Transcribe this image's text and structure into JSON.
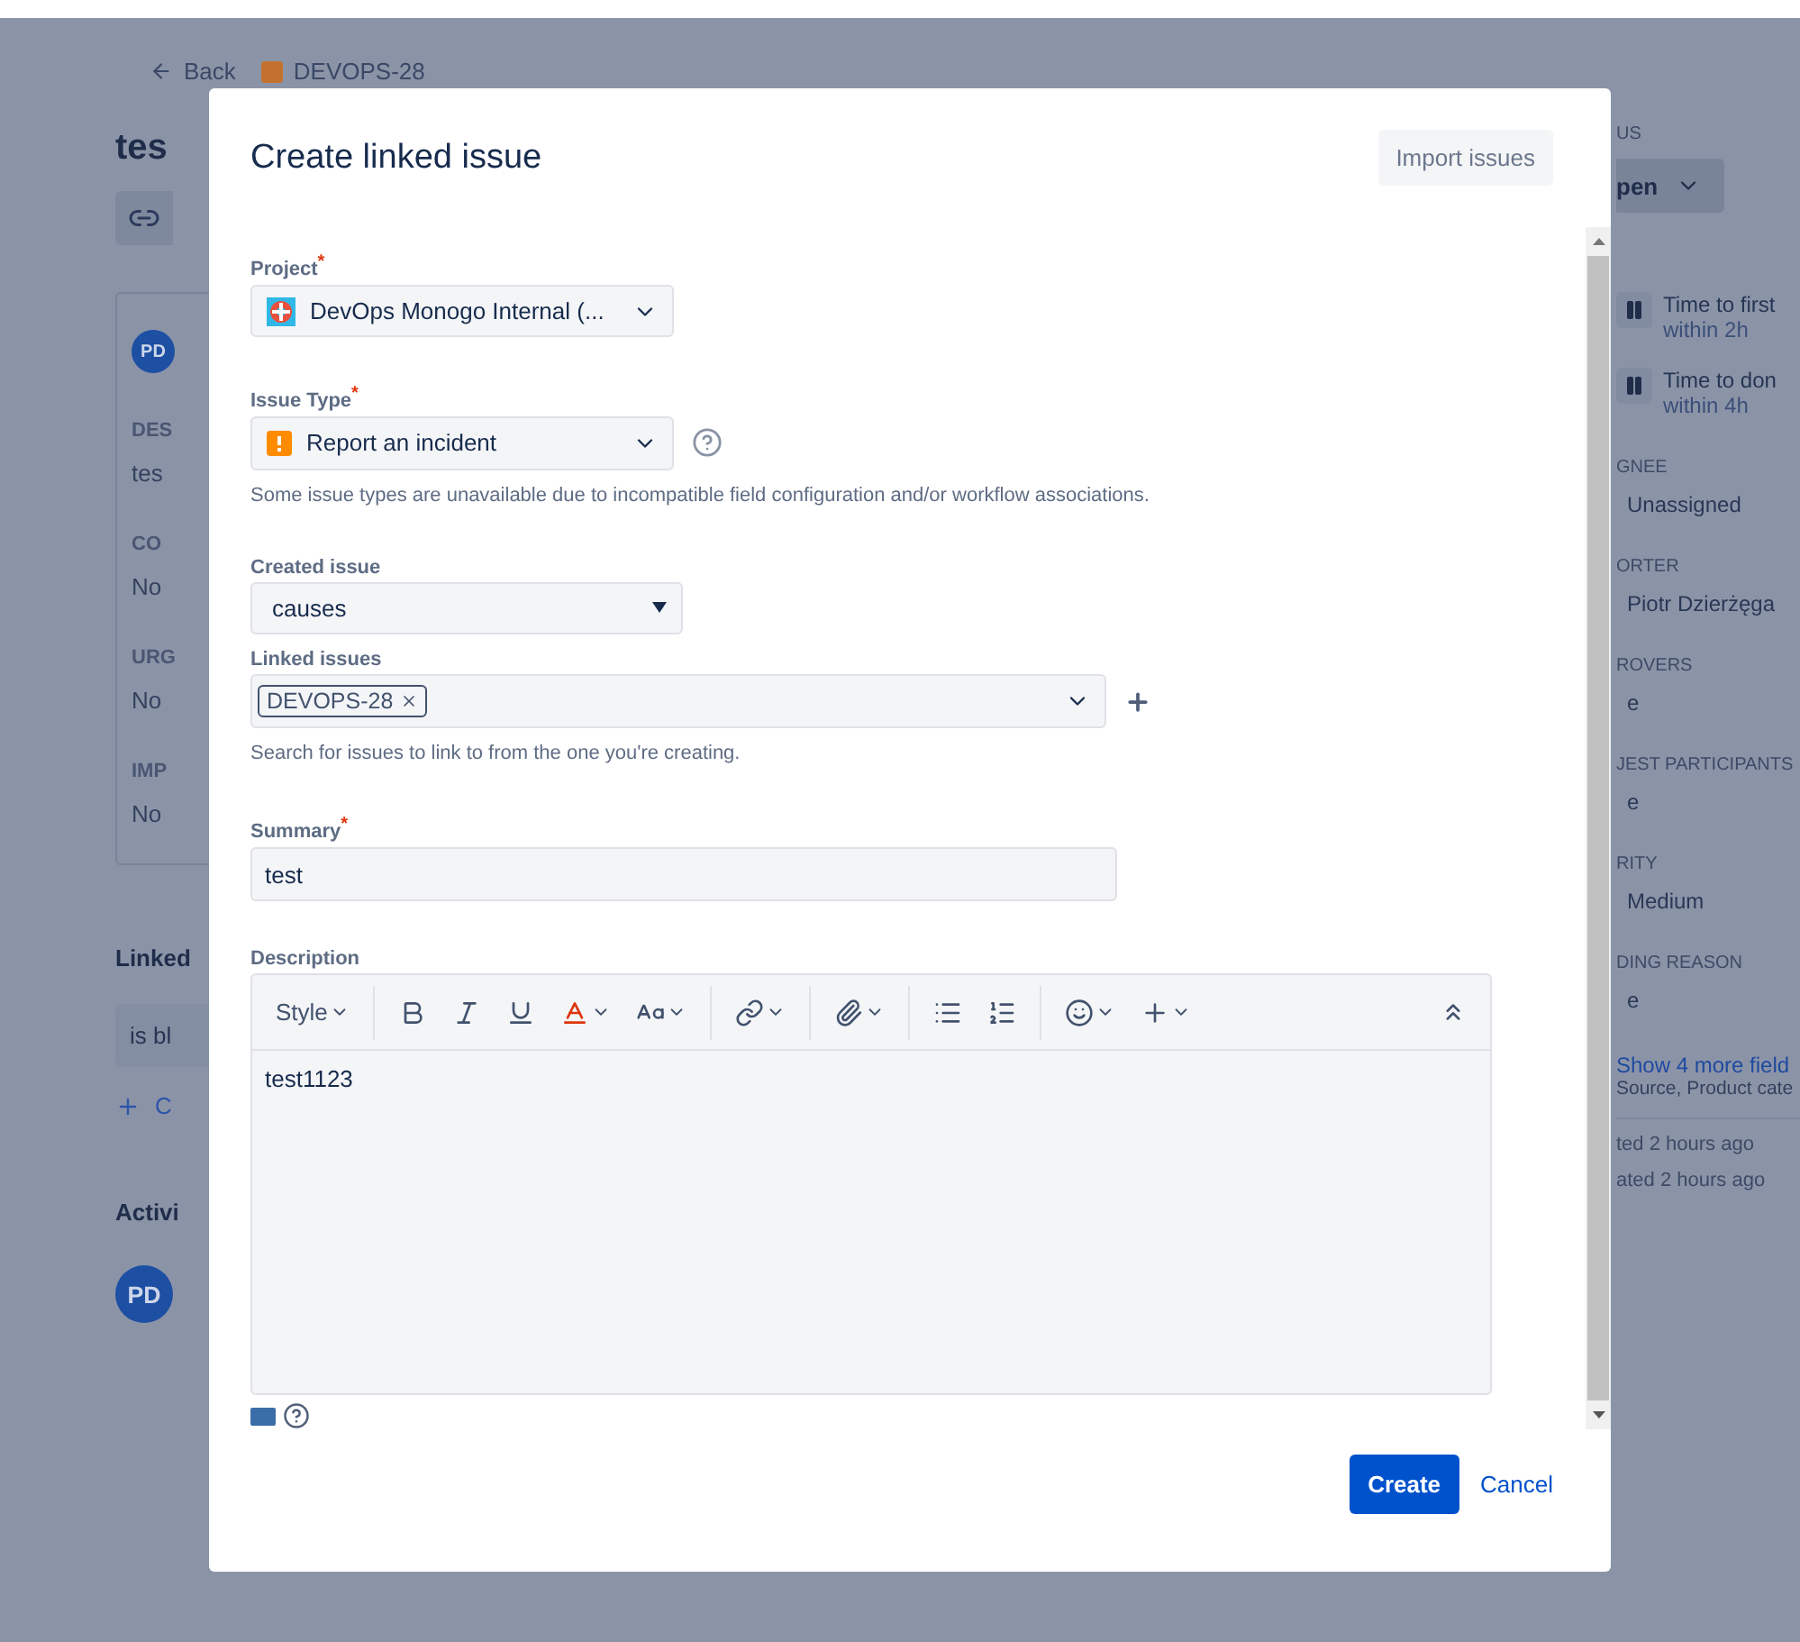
{
  "page": {
    "back": "Back",
    "issue_key": "DEVOPS-28",
    "title": "tes",
    "avatar": "PD",
    "fields": [
      {
        "label": "DES",
        "value": "tes"
      },
      {
        "label": "CO",
        "value": "No"
      },
      {
        "label": "URG",
        "value": "No"
      },
      {
        "label": "IMP",
        "value": "No"
      }
    ],
    "linked_heading": "Linked",
    "linked_item": "is bl",
    "create_link": "C",
    "activity_heading": "Activi",
    "activity_avatar": "PD"
  },
  "sidebar": {
    "status_label": "US",
    "status_button": "pen",
    "sla": [
      {
        "title": "Time to first",
        "due": "within 2h"
      },
      {
        "title": "Time to don",
        "due": "within 4h"
      }
    ],
    "fields": [
      {
        "label": "GNEE",
        "value": "Unassigned"
      },
      {
        "label": "ORTER",
        "value": "Piotr Dzierżęga"
      },
      {
        "label": "ROVERS",
        "value": "e"
      },
      {
        "label": "JEST PARTICIPANTS",
        "value": "e"
      },
      {
        "label": "RITY",
        "value": "Medium"
      },
      {
        "label": "DING REASON",
        "value": "e"
      }
    ],
    "show_more": "Show 4 more field",
    "show_more_hint": "Source, Product cate",
    "timestamps": [
      "ted 2 hours ago",
      "ated 2 hours ago"
    ]
  },
  "dialog": {
    "title": "Create linked issue",
    "import_button": "Import issues",
    "project": {
      "label": "Project$^{*}$",
      "value": "DevOps Monogo Internal (..."
    },
    "issue_type": {
      "label": "Issue Type$^{*}$",
      "value": "Report an incident",
      "hint": "Some issue types are unavailable due to incompatible field configuration and/or workflow associations."
    },
    "created_issue": {
      "label": "Created issue",
      "value": "causes"
    },
    "linked_issues": {
      "label": "Linked issues",
      "tags": [
        "DEVOPS-28"
      ],
      "hint": "Search for issues to link to from the one you're creating."
    },
    "summary": {
      "label": "Summary$^{*}$",
      "value": "test"
    },
    "description": {
      "label": "Description",
      "style_menu": "Style",
      "value": "test1123"
    },
    "create_button": "Create",
    "cancel_link": "Cancel"
  }
}
